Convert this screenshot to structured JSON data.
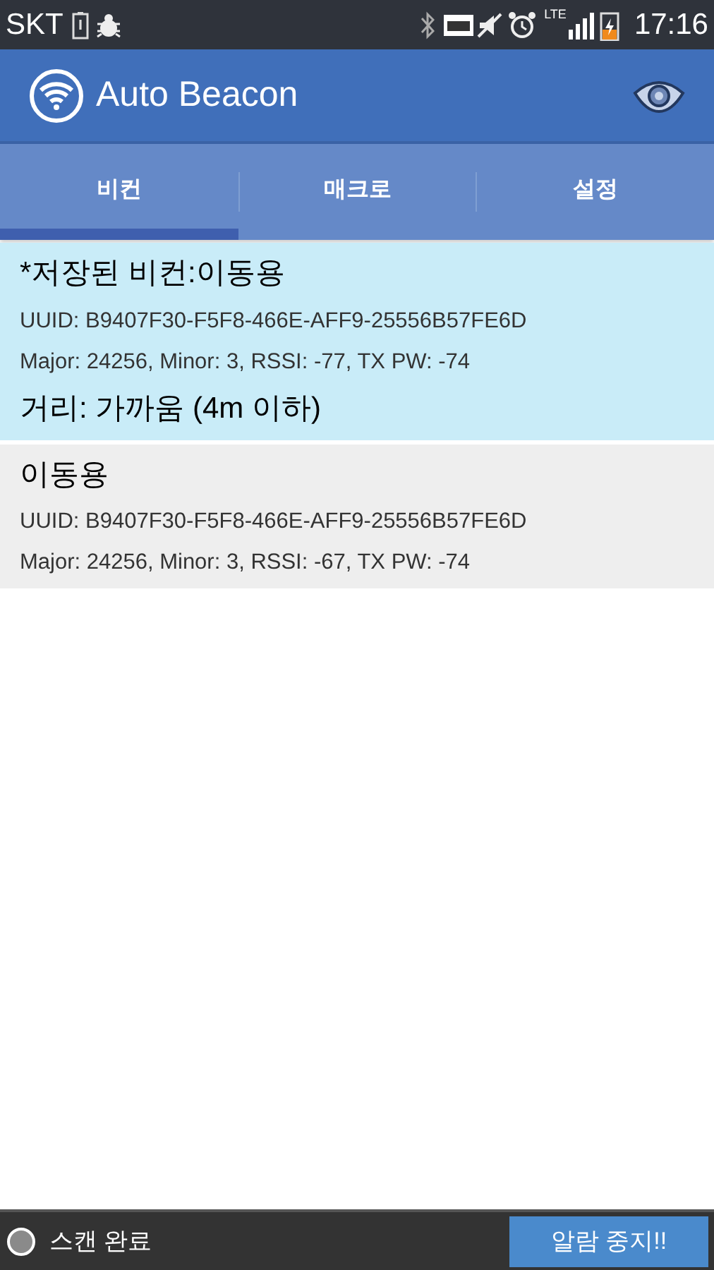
{
  "status_bar": {
    "carrier": "SKT",
    "network": "LTE",
    "time": "17:16"
  },
  "app_bar": {
    "title": "Auto Beacon"
  },
  "tabs": [
    {
      "label": "비컨",
      "selected": true
    },
    {
      "label": "매크로",
      "selected": false
    },
    {
      "label": "설정",
      "selected": false
    }
  ],
  "beacons": [
    {
      "name": "*저장된 비컨:이동용",
      "uuid": "UUID: B9407F30-F5F8-466E-AFF9-25556B57FE6D",
      "details": "Major: 24256, Minor: 3, RSSI: -77, TX PW: -74",
      "distance": "거리: 가까움 (4m 이하)",
      "selected": true
    },
    {
      "name": "이동용",
      "uuid": "UUID: B9407F30-F5F8-466E-AFF9-25556B57FE6D",
      "details": "Major: 24256, Minor: 3, RSSI: -67, TX PW: -74",
      "selected": false
    }
  ],
  "bottom_bar": {
    "scan_status": "스캔 완료",
    "button": "알람 중지!!"
  }
}
